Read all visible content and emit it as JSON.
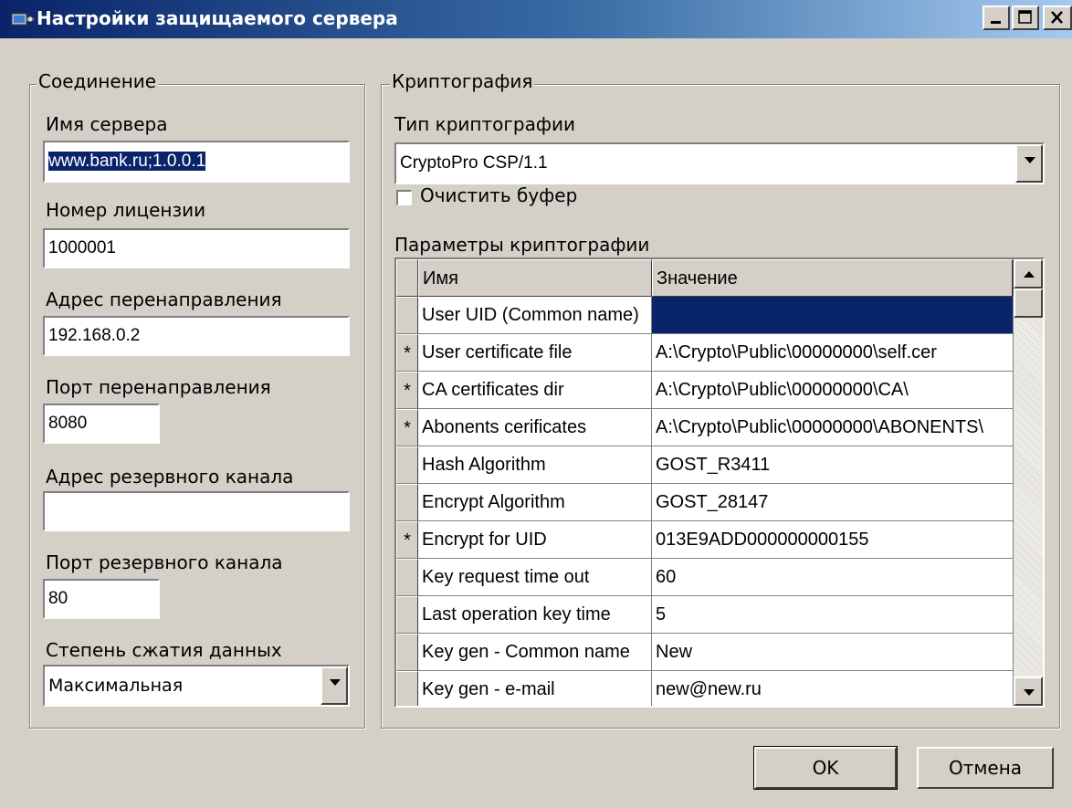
{
  "window": {
    "title": "Настройки защищаемого сервера",
    "icon": "server-app-icon"
  },
  "connection": {
    "group_title": "Соединение",
    "server_name": {
      "label": "Имя сервера",
      "value": "www.bank.ru;1.0.0.1"
    },
    "license_number": {
      "label": "Номер лицензии",
      "value": "1000001"
    },
    "redirect_address": {
      "label": "Адрес перенаправления",
      "value": "192.168.0.2"
    },
    "redirect_port": {
      "label": "Порт перенаправления",
      "value": "8080"
    },
    "backup_address": {
      "label": "Адрес резервного канала",
      "value": ""
    },
    "backup_port": {
      "label": "Порт резервного канала",
      "value": "80"
    },
    "compression": {
      "label": "Степень сжатия данных",
      "value": "Максимальная"
    }
  },
  "crypto": {
    "group_title": "Криптография",
    "type_label": "Тип криптографии",
    "type_value": "CryptoPro CSP/1.1",
    "clear_buffer_label": "Очистить буфер",
    "clear_buffer_checked": false,
    "params_label": "Параметры криптографии",
    "table": {
      "headers": [
        "Имя",
        "Значение"
      ],
      "rows": [
        {
          "mark": "",
          "name": "User UID (Common name)",
          "value": ""
        },
        {
          "mark": "*",
          "name": "User certificate file",
          "value": "A:\\Crypto\\Public\\00000000\\self.cer"
        },
        {
          "mark": "*",
          "name": "CA certificates dir",
          "value": "A:\\Crypto\\Public\\00000000\\CA\\"
        },
        {
          "mark": "*",
          "name": "Abonents cerificates",
          "value": "A:\\Crypto\\Public\\00000000\\ABONENTS\\"
        },
        {
          "mark": "",
          "name": "Hash Algorithm",
          "value": "GOST_R3411"
        },
        {
          "mark": "",
          "name": "Encrypt Algorithm",
          "value": "GOST_28147"
        },
        {
          "mark": "*",
          "name": "Encrypt for UID",
          "value": "013E9ADD000000000155"
        },
        {
          "mark": "",
          "name": "Key request time out",
          "value": "60"
        },
        {
          "mark": "",
          "name": "Last operation key time",
          "value": "5"
        },
        {
          "mark": "",
          "name": "Key gen - Common name",
          "value": "New"
        },
        {
          "mark": "",
          "name": "Key gen - e-mail",
          "value": "new@new.ru"
        }
      ]
    }
  },
  "buttons": {
    "ok": "OK",
    "cancel": "Отмена"
  }
}
